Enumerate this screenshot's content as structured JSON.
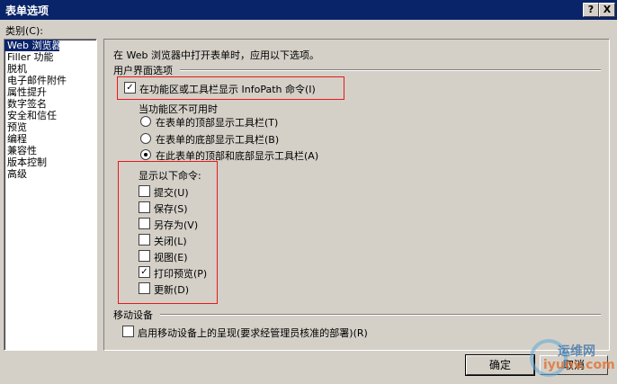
{
  "window": {
    "title": "表单选项",
    "help_glyph": "?",
    "close_glyph": "X"
  },
  "categories": {
    "label": "类别(C):",
    "items": [
      "Web 浏览器",
      "Filler 功能",
      "脱机",
      "电子邮件附件",
      "属性提升",
      "数字签名",
      "安全和信任",
      "预览",
      "编程",
      "兼容性",
      "版本控制",
      "高级"
    ],
    "selected_index": 0
  },
  "panel": {
    "intro": "在 Web 浏览器中打开表单时，应用以下选项。",
    "ui_group": "用户界面选项",
    "show_in_ribbon": {
      "label": "在功能区或工具栏显示 InfoPath 命令(I)",
      "checked": true
    },
    "when_unavailable": {
      "label": "当功能区不可用时",
      "options": [
        {
          "label": "在表单的顶部显示工具栏(T)",
          "selected": false
        },
        {
          "label": "在表单的底部显示工具栏(B)",
          "selected": false
        },
        {
          "label": "在此表单的顶部和底部显示工具栏(A)",
          "selected": true
        }
      ]
    },
    "commands": {
      "label": "显示以下命令:",
      "items": [
        {
          "label": "提交(U)",
          "checked": false
        },
        {
          "label": "保存(S)",
          "checked": false
        },
        {
          "label": "另存为(V)",
          "checked": false
        },
        {
          "label": "关闭(L)",
          "checked": false
        },
        {
          "label": "视图(E)",
          "checked": false
        },
        {
          "label": "打印预览(P)",
          "checked": true
        },
        {
          "label": "更新(D)",
          "checked": false
        }
      ]
    },
    "mobile_group": "移动设备",
    "mobile_render": {
      "label": "启用移动设备上的呈现(要求经管理员核准的部署)(R)",
      "checked": false
    }
  },
  "buttons": {
    "ok": "确定",
    "cancel": "取消"
  },
  "watermark": {
    "line1": "运维网",
    "line2": "iyunv.com"
  },
  "colors": {
    "titlebar": "#0a246a",
    "face": "#d4d0c8",
    "highlight_box": "#e81818"
  }
}
